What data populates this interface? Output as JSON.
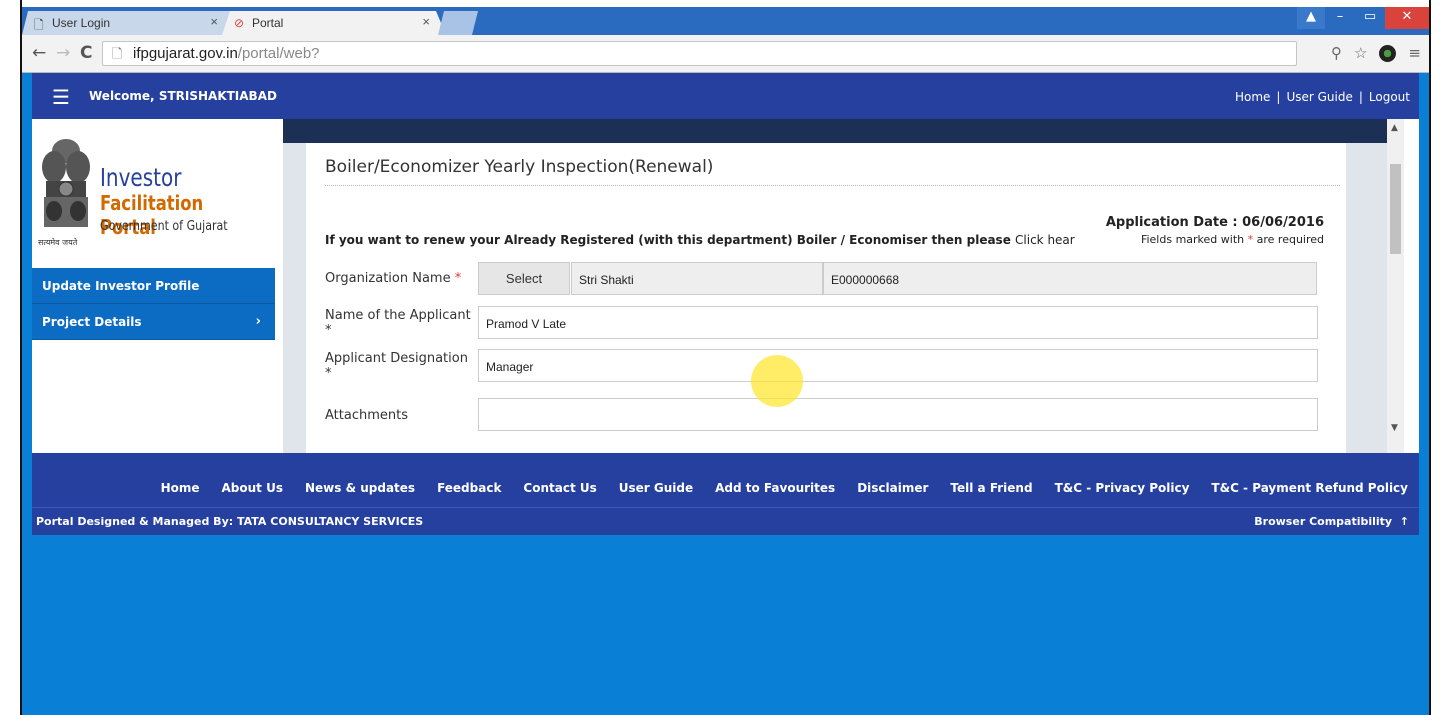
{
  "browser": {
    "tabs": [
      {
        "label": "User Login",
        "icon": "page-icon",
        "active": false
      },
      {
        "label": "Portal",
        "icon": "portal-icon",
        "active": true
      }
    ],
    "url_host": "ifpgujarat.gov.in",
    "url_path": "/portal/web?"
  },
  "header": {
    "welcome_prefix": "Welcome,",
    "username": "STRISHAKTIABAD",
    "links": [
      "Home",
      "User Guide",
      "Logout"
    ]
  },
  "logo": {
    "line1": "Investor",
    "line2": "Facilitation Portal",
    "line3": "Government of Gujarat",
    "motto": "सत्यमेव जयते"
  },
  "sidebar": {
    "items": [
      {
        "label": "Update Investor Profile"
      },
      {
        "label": "Project Details"
      }
    ]
  },
  "form": {
    "title": "Boiler/Economizer Yearly Inspection(Renewal)",
    "application_date": "Application Date : 06/06/2016",
    "renew_text": "If you want to renew your Already Registered (with this department) Boiler / Economiser then please",
    "renew_link": "Click hear",
    "required_note_pre": "Fields marked with",
    "required_note_post": "are required",
    "org_label": "Organization Name",
    "select_label": "Select",
    "org_name": "Stri Shakti",
    "org_code": "E000000668",
    "applicant_label": "Name of the Applicant",
    "applicant_value": "Pramod V Late",
    "designation_label": "Applicant Designation",
    "designation_value": "Manager",
    "attachments_label": "Attachments",
    "required_mark": "*"
  },
  "footer": {
    "links": [
      "Home",
      "About Us",
      "News & updates",
      "Feedback",
      "Contact Us",
      "User Guide",
      "Add to Favourites",
      "Disclaimer",
      "Tell a Friend",
      "T&C - Privacy Policy",
      "T&C - Payment Refund Policy"
    ],
    "credits": "Portal Designed & Managed By: TATA CONSULTANCY SERVICES",
    "compat": "Browser Compatibility"
  },
  "colors": {
    "header_bg": "#26409f",
    "sidebar_bg": "#0c6bc2",
    "page_bg": "#0a7fd6",
    "required": "#e53935"
  }
}
